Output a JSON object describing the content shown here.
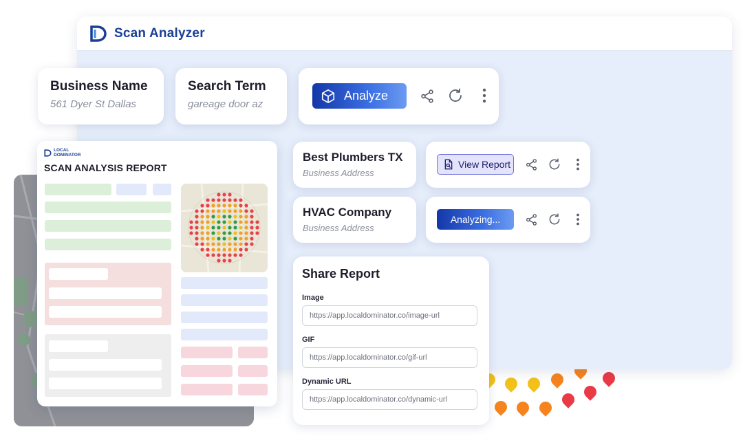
{
  "app": {
    "title": "Scan Analyzer"
  },
  "search_form": {
    "business_name": {
      "label": "Business Name",
      "value": "561 Dyer St Dallas"
    },
    "search_term": {
      "label": "Search Term",
      "value": "gareage door az"
    },
    "analyze_label": "Analyze"
  },
  "results": [
    {
      "name": "Best Plumbers TX",
      "address": "Business Address",
      "action_label": "View Report"
    },
    {
      "name": "HVAC Company",
      "address": "Business Address",
      "action_label": "Analyzing..."
    }
  ],
  "share": {
    "title": "Share Report",
    "fields": [
      {
        "label": "Image",
        "value": "https://app.localdominator.co/image-url"
      },
      {
        "label": "GIF",
        "value": "https://app.localdominator.co/gif-url"
      },
      {
        "label": "Dynamic URL",
        "value": "https://app.localdominator.co/dynamic-url"
      }
    ]
  },
  "report": {
    "brand_line1": "LOCAL",
    "brand_line2": "DOMINATOR",
    "heading": "SCAN ANALYSIS REPORT"
  },
  "icons": {
    "analyze": "cube-icon",
    "share": "share-icon",
    "refresh": "refresh-icon",
    "more": "more-vertical-icon",
    "view_report": "search-document-icon"
  },
  "colors": {
    "brand": "#1b3f97",
    "button_gradient_start": "#1437a8",
    "button_gradient_end": "#6b9bf1",
    "view_report_bg": "#e3e3fc",
    "panel_bg": "#e6eefb"
  }
}
